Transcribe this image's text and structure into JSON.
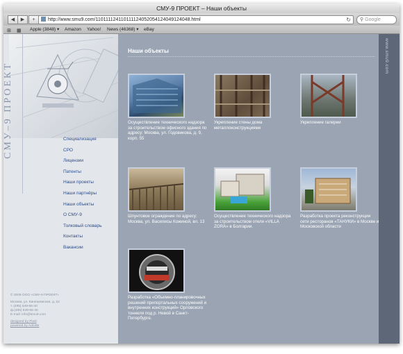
{
  "window": {
    "title": "СМУ-9 ПРОЕКТ – Наши объекты"
  },
  "toolbar": {
    "back_icon": "back-arrow-icon",
    "forward_icon": "forward-arrow-icon",
    "add_icon": "plus-icon",
    "url": "http://www.smu9.com/110111124110111124052054124049124048.html",
    "search_placeholder": "Google"
  },
  "bookmarks": {
    "items": [
      {
        "label": "Apple (3848) ▾"
      },
      {
        "label": "Amazon"
      },
      {
        "label": "Yahoo!"
      },
      {
        "label": "News (46368) ▾"
      },
      {
        "label": "eBay"
      }
    ]
  },
  "sidebar": {
    "title": "СМУ–9 ПРОЕКТ",
    "menu": [
      {
        "label": "Специализация"
      },
      {
        "label": "СРО"
      },
      {
        "label": "Лицензии"
      },
      {
        "label": "Патенты"
      },
      {
        "label": "Наши проекты"
      },
      {
        "label": "Наши партнёры"
      },
      {
        "label": "Наши объекты"
      },
      {
        "label": "О СМУ-9"
      },
      {
        "label": "Толковый словарь"
      },
      {
        "label": "Контакты"
      },
      {
        "label": "Вакансии"
      }
    ],
    "footer": {
      "copyright": "© 2009 ООО «СМУ-9 ПРОЕКТ»",
      "address": "Москва, ул. Кинешемская, д. 22",
      "phone": "т. (495) 649-65-40",
      "fax": "ф.(495) 649-65-40",
      "email": "E-mail: info@smu9.com",
      "designed": "designed by Pixel",
      "powered": "powered by Adrotte"
    }
  },
  "main": {
    "heading": "Наши объекты",
    "items": [
      {
        "caption": "Осуществление технического надзора за строительством офисного здания по адресу: Москва, ул. Годовикова, д. 9, корп. 55"
      },
      {
        "caption": "Укрепление стены дома металлоконструкциями"
      },
      {
        "caption": "Укрепление галереи"
      },
      {
        "caption": "Шпунтовое ограждение по адресу: Москва, ул. Василисы Кожиной, вл. 13"
      },
      {
        "caption": "Осуществление технического надзора за строительством отеля «VILLA ZORA» в Болгарии."
      },
      {
        "caption": "Разработка проекта реконструкции сети ресторанов «ТАНУКИ» в Москве и Московской области"
      },
      {
        "caption": "Разработка «Объемно-планировочных решений припортальных сооружений и внутренних конструкций» Орловского тоннеля под р. Невой в Санкт-Петербурге."
      }
    ]
  },
  "rightbar": {
    "site": "www.smu9.com"
  }
}
